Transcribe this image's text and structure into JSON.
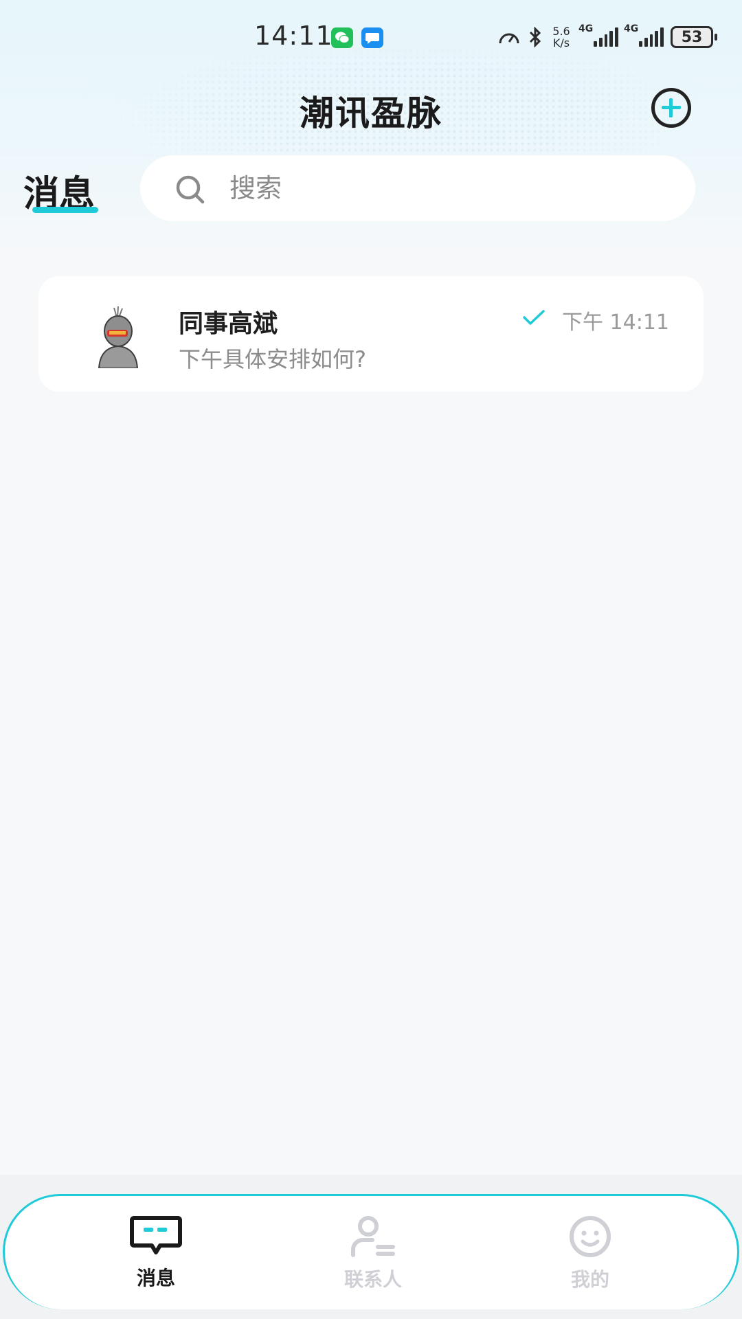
{
  "status_bar": {
    "time": "14:11",
    "net_speed": "5.6 K/s",
    "network_1": "4G",
    "network_2": "4G",
    "battery": "53"
  },
  "header": {
    "app_title": "潮讯盈脉",
    "page_title": "消息"
  },
  "search": {
    "placeholder": "搜索"
  },
  "conversations": [
    {
      "name": "同事高斌",
      "preview": "下午具体安排如何?",
      "time": "下午 14:11",
      "read": true
    }
  ],
  "bottom_nav": {
    "items": [
      {
        "label": "消息",
        "active": true
      },
      {
        "label": "联系人",
        "active": false
      },
      {
        "label": "我的",
        "active": false
      }
    ]
  },
  "colors": {
    "accent": "#1fcbd8",
    "inactive": "#cfcfd6",
    "background": "#f6f8fa"
  },
  "icons": [
    "wechat-icon",
    "message-app-icon",
    "speedometer-icon",
    "bluetooth-icon",
    "signal-icon",
    "battery-icon",
    "add-icon",
    "search-icon",
    "read-check-icon",
    "chat-icon",
    "contacts-icon",
    "smiley-icon"
  ]
}
